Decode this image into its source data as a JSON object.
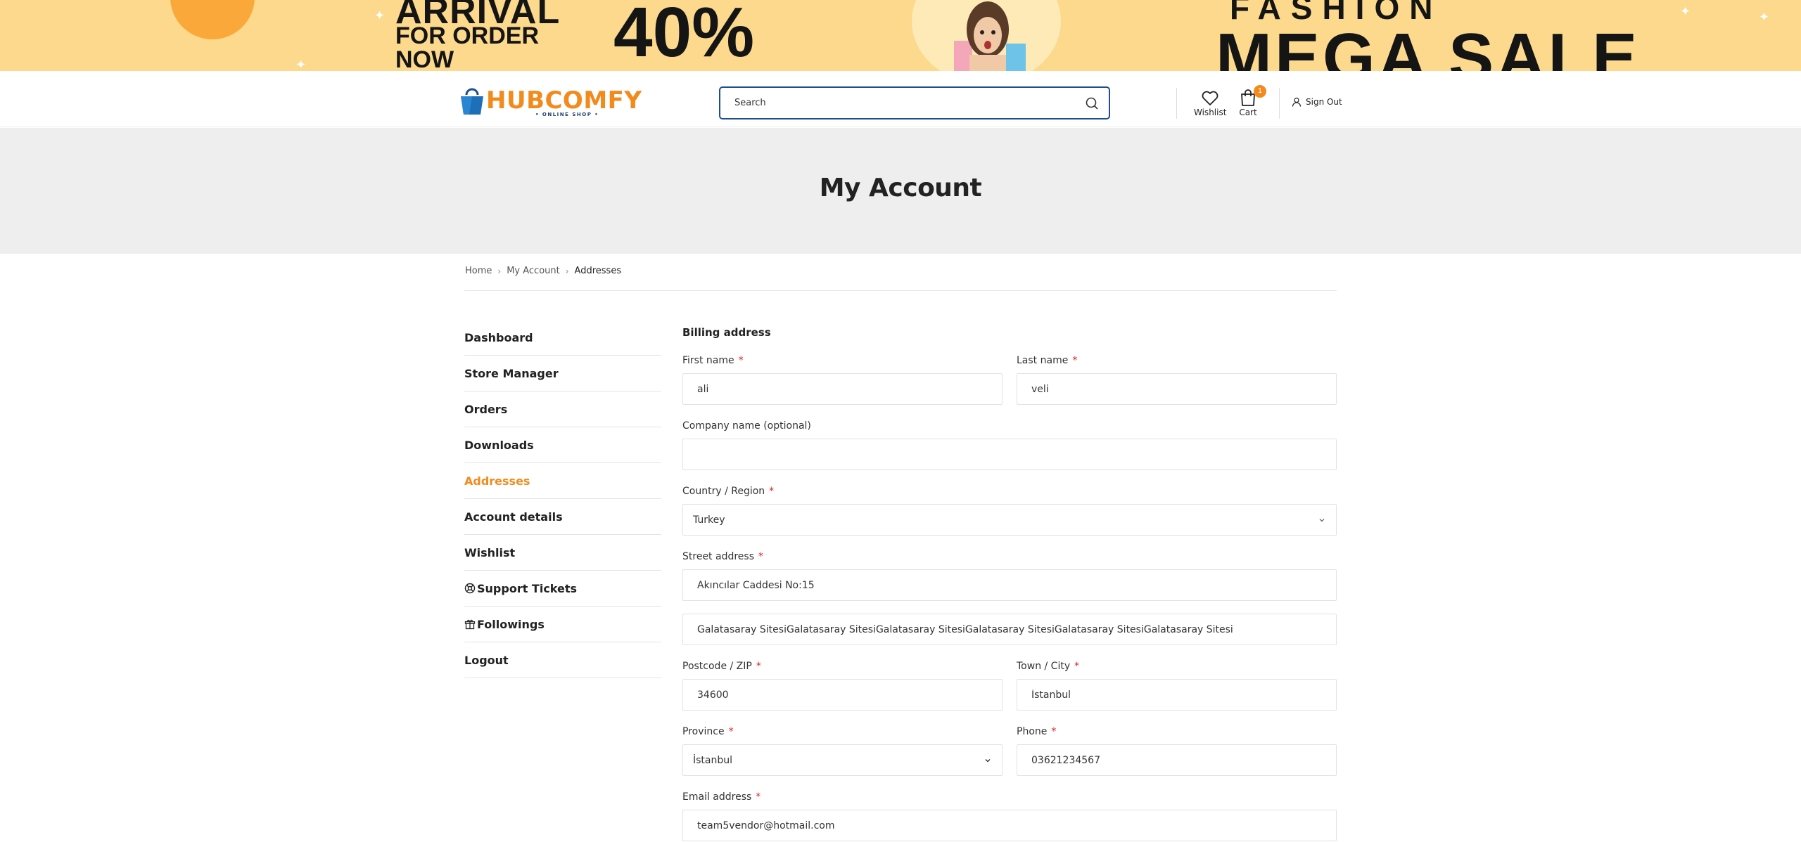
{
  "banner": {
    "arrival": "ARRIVAL",
    "for_order": "FOR ORDER",
    "now": "NOW",
    "percent": "40%",
    "fashion": "FASHION",
    "mega_sale": "MEGA SALE"
  },
  "header": {
    "logo_text": "HUBCOMFY",
    "logo_sub": "• ONLINE SHOP •",
    "search_placeholder": "Search",
    "wishlist_label": "Wishlist",
    "cart_label": "Cart",
    "cart_count": "1",
    "signout_label": "Sign Out"
  },
  "page": {
    "title": "My Account"
  },
  "breadcrumb": {
    "home": "Home",
    "my_account": "My Account",
    "current": "Addresses"
  },
  "sidebar": {
    "items": [
      {
        "label": "Dashboard"
      },
      {
        "label": "Store Manager"
      },
      {
        "label": "Orders"
      },
      {
        "label": "Downloads"
      },
      {
        "label": "Addresses"
      },
      {
        "label": "Account details"
      },
      {
        "label": "Wishlist"
      },
      {
        "label": "Support Tickets"
      },
      {
        "label": "Followings"
      },
      {
        "label": "Logout"
      }
    ]
  },
  "form": {
    "title": "Billing address",
    "first_name": {
      "label": "First name",
      "value": "ali"
    },
    "last_name": {
      "label": "Last name",
      "value": "veli"
    },
    "company": {
      "label": "Company name (optional)",
      "value": ""
    },
    "country": {
      "label": "Country / Region",
      "value": "Turkey"
    },
    "street": {
      "label": "Street address",
      "line1": "Akıncılar Caddesi No:15",
      "line2": "Galatasaray SitesiGalatasaray SitesiGalatasaray SitesiGalatasaray SitesiGalatasaray SitesiGalatasaray Sitesi"
    },
    "postcode": {
      "label": "Postcode / ZIP",
      "value": "34600"
    },
    "city": {
      "label": "Town / City",
      "value": "İstanbul"
    },
    "province": {
      "label": "Province",
      "value": "İstanbul"
    },
    "phone": {
      "label": "Phone",
      "value": "03621234567"
    },
    "email": {
      "label": "Email address",
      "value": "team5vendor@hotmail.com"
    },
    "required_mark": "*"
  },
  "colors": {
    "accent": "#f28a1c",
    "search_border": "#1d4f8a",
    "required": "#e0232b",
    "banner_bg": "#fcd98c"
  }
}
